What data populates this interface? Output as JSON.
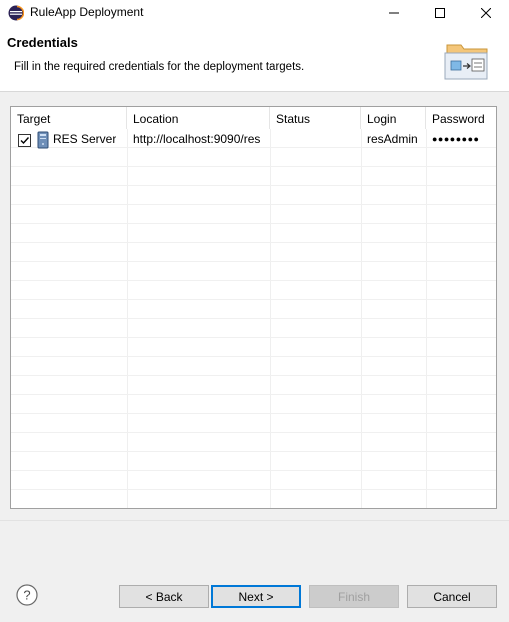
{
  "window": {
    "title": "RuleApp Deployment"
  },
  "header": {
    "title": "Credentials",
    "description": "Fill in the required credentials for the deployment targets."
  },
  "table": {
    "columns": [
      "Target",
      "Location",
      "Status",
      "Login",
      "Password"
    ],
    "rows": [
      {
        "checked": true,
        "target": "RES Server",
        "location": "http://localhost:9090/res",
        "status": "",
        "login": "resAdmin",
        "password": "●●●●●●●●"
      }
    ],
    "empty_rows": 18
  },
  "buttons": {
    "back": "< Back",
    "next": "Next >",
    "finish": "Finish",
    "cancel": "Cancel"
  },
  "icons": {
    "app": "eclipse-icon",
    "help": "help-icon",
    "server": "server-icon",
    "banner": "wizard-banner-icon"
  },
  "colors": {
    "focus_border": "#0078d7",
    "disabled_text": "#a0a0a0"
  }
}
